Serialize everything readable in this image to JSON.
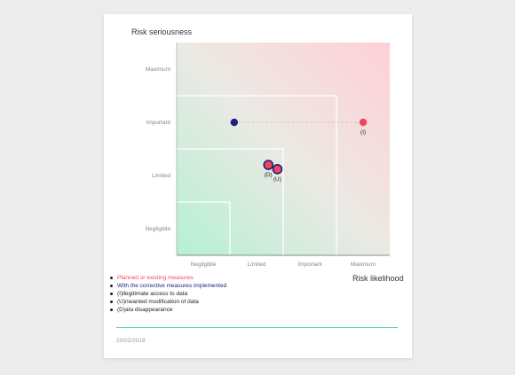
{
  "chart_data": {
    "type": "scatter",
    "ylabel": "Risk seriousness",
    "xlabel": "Risk likelihood",
    "levels": [
      "Negligible",
      "Limited",
      "Important",
      "Maximum"
    ],
    "xlim": [
      0.5,
      4.5
    ],
    "ylim": [
      0.5,
      4.5
    ],
    "zones": [
      {
        "x_max": 1.5,
        "y_max": 1.5
      },
      {
        "x_max": 2.5,
        "y_max": 2.5
      },
      {
        "x_max": 3.5,
        "y_max": 3.5
      }
    ],
    "points": [
      {
        "label": "(I)",
        "planned": {
          "x": 1.58,
          "y": 3.0
        },
        "existing": {
          "x": 4.0,
          "y": 3.0
        }
      },
      {
        "label": "(D)",
        "planned": {
          "x": 2.22,
          "y": 2.2
        },
        "existing": {
          "x": 2.22,
          "y": 2.2
        }
      },
      {
        "label": "(U)",
        "planned": {
          "x": 2.39,
          "y": 2.12
        },
        "existing": {
          "x": 2.39,
          "y": 2.12
        }
      }
    ],
    "grid": false
  },
  "legend": [
    {
      "text": "Planned or existing measures",
      "color": "#f0475e"
    },
    {
      "text": "With the corrective measures implemented",
      "color": "#1a237e"
    },
    {
      "text": "(I)llegitimate access to data",
      "color": "#222222"
    },
    {
      "text": "(U)nwanted modification of data",
      "color": "#222222"
    },
    {
      "text": "(D)ata disappearance",
      "color": "#222222"
    }
  ],
  "date": "20/02/2018",
  "colors": {
    "existing": "#f0475e",
    "planned": "#1a237e",
    "green": "#aef0d0",
    "red": "#ffd0d6",
    "accent": "#4cd6a0"
  }
}
